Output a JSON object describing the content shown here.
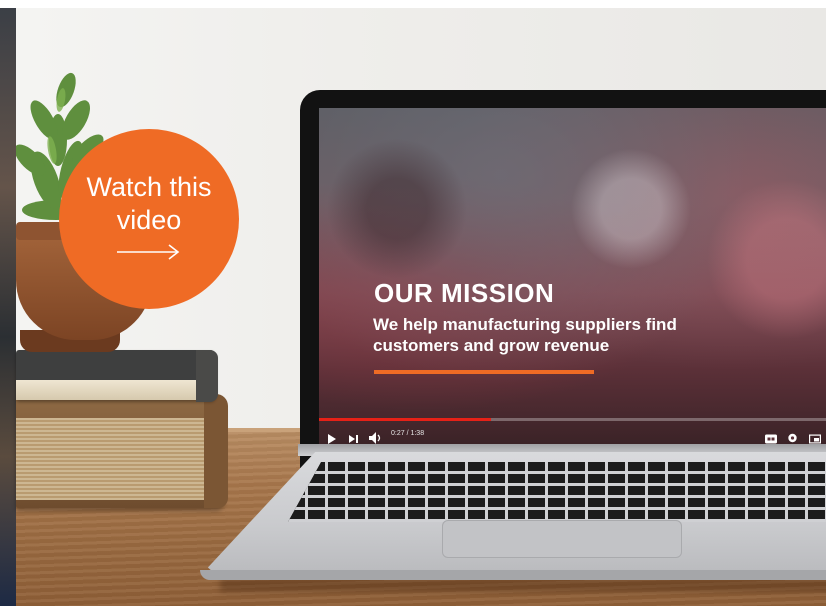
{
  "cta": {
    "line1": "Watch this",
    "line2": "video",
    "icon": "arrow-right-icon",
    "color": "#ef6b25"
  },
  "video": {
    "title": "OUR MISSION",
    "subtitle_line1": "We help manufacturing suppliers find",
    "subtitle_line2": "customers and grow revenue",
    "accent_color": "#ef6b25",
    "progress": 0.33,
    "time": "0:27 / 1:38",
    "controls": {
      "play": "play-icon",
      "next": "next-icon",
      "volume": "volume-icon",
      "captions": "captions-icon",
      "settings": "gear-icon",
      "theater": "theater-mode-icon"
    }
  }
}
